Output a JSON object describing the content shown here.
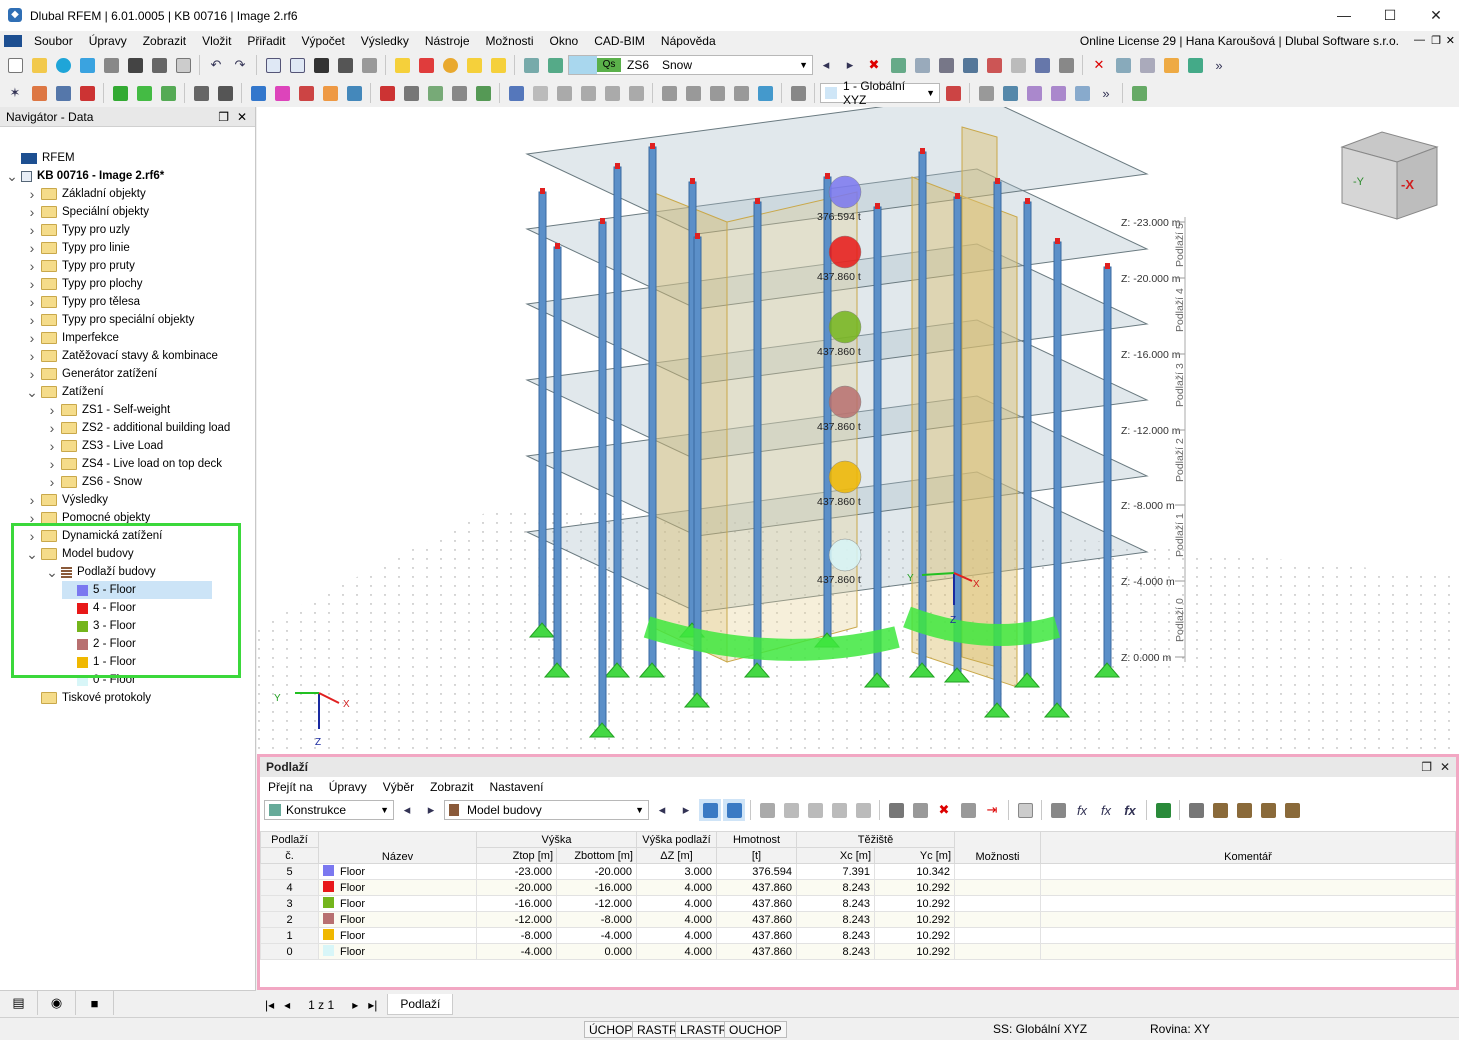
{
  "window": {
    "title": "Dlubal RFEM | 6.01.0005 | KB 00716 | Image 2.rf6"
  },
  "menu": {
    "items": [
      "Soubor",
      "Úpravy",
      "Zobrazit",
      "Vložit",
      "Přiřadit",
      "Výpočet",
      "Výsledky",
      "Nástroje",
      "Možnosti",
      "Okno",
      "CAD-BIM",
      "Nápověda"
    ],
    "license": "Online License 29 | Hana Karoušová | Dlubal Software s.r.o."
  },
  "toolbar": {
    "load_badge": "Qs",
    "load_case": "ZS6",
    "load_name": "Snow",
    "coord_system": "1 - Globální XYZ"
  },
  "navigator": {
    "title": "Navigátor - Data",
    "root": "RFEM",
    "file": "KB 00716 - Image 2.rf6*",
    "folders": [
      "Základní objekty",
      "Speciální objekty",
      "Typy pro uzly",
      "Typy pro linie",
      "Typy pro pruty",
      "Typy pro plochy",
      "Typy pro tělesa",
      "Typy pro speciální objekty",
      "Imperfekce",
      "Zatěžovací stavy & kombinace",
      "Generátor zatížení",
      "Zatížení"
    ],
    "loads": [
      "ZS1 - Self-weight",
      "ZS2 - additional building load",
      "ZS3 - Live Load",
      "ZS4 - Live load on top deck",
      "ZS6 - Snow"
    ],
    "after": [
      "Výsledky",
      "Pomocné objekty",
      "Dynamická zatížení",
      "Model budovy"
    ],
    "storeys_group": "Podlaží budovy",
    "storeys": [
      {
        "label": "5 - Floor",
        "color": "#7b78f0"
      },
      {
        "label": "4 - Floor",
        "color": "#e81818"
      },
      {
        "label": "3 - Floor",
        "color": "#74b51c"
      },
      {
        "label": "2 - Floor",
        "color": "#b87070"
      },
      {
        "label": "1 - Floor",
        "color": "#f0b800"
      },
      {
        "label": "0 - Floor",
        "color": "#d8f6f8"
      }
    ],
    "last": "Tiskové protokoly"
  },
  "view": {
    "levels": [
      "Z: -23.000 m",
      "Z: -20.000 m",
      "Z: -16.000 m",
      "Z: -12.000 m",
      "Z: -8.000 m",
      "Z: -4.000 m",
      "Z: 0.000 m"
    ],
    "storey_labels": [
      "Podlaží 5",
      "Podlaží 4",
      "Podlaží 3",
      "Podlaží 2",
      "Podlaží 1",
      "Podlaží 0"
    ],
    "masses": [
      "376.594 t",
      "437.860 t",
      "437.860 t",
      "437.860 t",
      "437.860 t",
      "437.860 t"
    ],
    "axis": {
      "x": "X",
      "y": "Y",
      "z": "Z"
    },
    "cube": {
      "y": "-Y",
      "x": "-X"
    }
  },
  "panel": {
    "title": "Podlaží",
    "menu": [
      "Přejít na",
      "Úpravy",
      "Výběr",
      "Zobrazit",
      "Nastavení"
    ],
    "combo1": "Konstrukce",
    "combo2": "Model budovy",
    "headers": {
      "storey": "Podlaží",
      "storey2": "č.",
      "name": "Název",
      "height": "Výška",
      "ztop": "Ztop [m]",
      "zbottom": "Zbottom [m]",
      "dz1": "Výška podlaží",
      "dz2": "ΔZ [m]",
      "mass1": "Hmotnost",
      "mass2": "[t]",
      "cg": "Těžiště",
      "xc": "Xc [m]",
      "yc": "Yc [m]",
      "opts": "Možnosti",
      "comment": "Komentář"
    },
    "rows": [
      {
        "no": "5",
        "name": "Floor",
        "color": "#7b78f0",
        "ztop": "-23.000",
        "zbot": "-20.000",
        "dz": "3.000",
        "mass": "376.594",
        "xc": "7.391",
        "yc": "10.342"
      },
      {
        "no": "4",
        "name": "Floor",
        "color": "#e81818",
        "ztop": "-20.000",
        "zbot": "-16.000",
        "dz": "4.000",
        "mass": "437.860",
        "xc": "8.243",
        "yc": "10.292"
      },
      {
        "no": "3",
        "name": "Floor",
        "color": "#74b51c",
        "ztop": "-16.000",
        "zbot": "-12.000",
        "dz": "4.000",
        "mass": "437.860",
        "xc": "8.243",
        "yc": "10.292"
      },
      {
        "no": "2",
        "name": "Floor",
        "color": "#b87070",
        "ztop": "-12.000",
        "zbot": "-8.000",
        "dz": "4.000",
        "mass": "437.860",
        "xc": "8.243",
        "yc": "10.292"
      },
      {
        "no": "1",
        "name": "Floor",
        "color": "#f0b800",
        "ztop": "-8.000",
        "zbot": "-4.000",
        "dz": "4.000",
        "mass": "437.860",
        "xc": "8.243",
        "yc": "10.292"
      },
      {
        "no": "0",
        "name": "Floor",
        "color": "#d8f6f8",
        "ztop": "-4.000",
        "zbot": "0.000",
        "dz": "4.000",
        "mass": "437.860",
        "xc": "8.243",
        "yc": "10.292"
      }
    ],
    "pager": "1 z 1",
    "tab": "Podlaží"
  },
  "status": {
    "buttons": [
      "ÚCHOP",
      "RASTR",
      "LRASTR",
      "OUCHOP"
    ],
    "cs": "SS: Globální XYZ",
    "plane": "Rovina: XY"
  }
}
